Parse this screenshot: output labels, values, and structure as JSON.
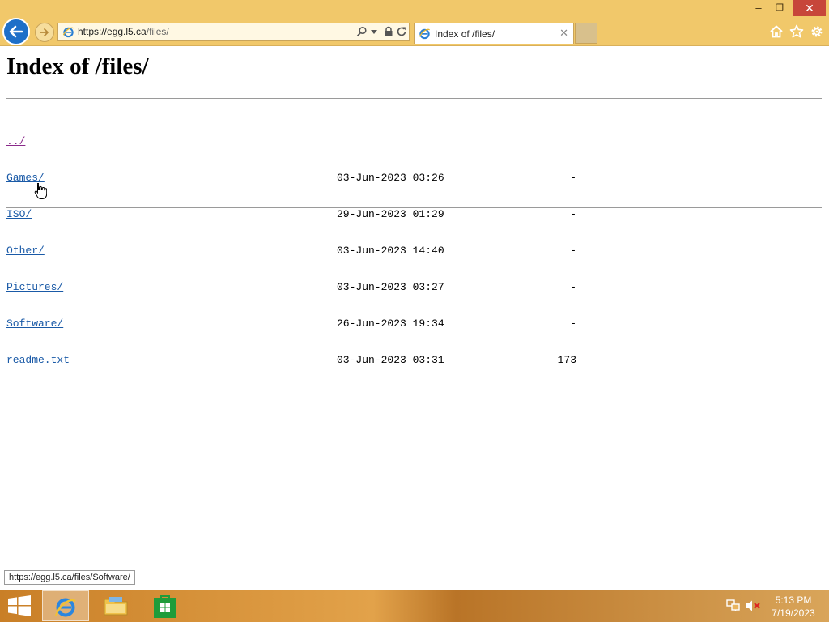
{
  "browser": {
    "window_controls": {
      "minimize": "–",
      "maximize": "❐",
      "close": "✕"
    },
    "address_bar": {
      "url_host": "https://egg.l5.ca",
      "url_path": "/files/"
    },
    "tab": {
      "title": "Index of /files/",
      "close": "✕"
    },
    "status_tooltip": "https://egg.l5.ca/files/Software/",
    "icons": [
      "back-arrow-icon",
      "forward-arrow-icon",
      "ie-icon",
      "search-icon",
      "lock-icon",
      "refresh-icon",
      "home-icon",
      "favorites-star-icon",
      "gear-icon"
    ]
  },
  "page": {
    "title": "Index of /files/",
    "entries": [
      {
        "name": "../",
        "date": "",
        "size": ""
      },
      {
        "name": "Games/",
        "date": "03-Jun-2023 03:26",
        "size": "-"
      },
      {
        "name": "ISO/",
        "date": "29-Jun-2023 01:29",
        "size": "-"
      },
      {
        "name": "Other/",
        "date": "03-Jun-2023 14:40",
        "size": "-"
      },
      {
        "name": "Pictures/",
        "date": "03-Jun-2023 03:27",
        "size": "-"
      },
      {
        "name": "Software/",
        "date": "26-Jun-2023 19:34",
        "size": "-"
      },
      {
        "name": "readme.txt",
        "date": "03-Jun-2023 03:31",
        "size": "173"
      }
    ]
  },
  "taskbar": {
    "apps": [
      "internet-explorer",
      "file-explorer",
      "windows-store"
    ],
    "clock": {
      "time": "5:13 PM",
      "date": "7/19/2023"
    }
  },
  "colors": {
    "chrome": "#f1c86a",
    "link": "#1a5aa7",
    "visited_link": "#8a2a8a",
    "back_button": "#1e6fc8"
  }
}
